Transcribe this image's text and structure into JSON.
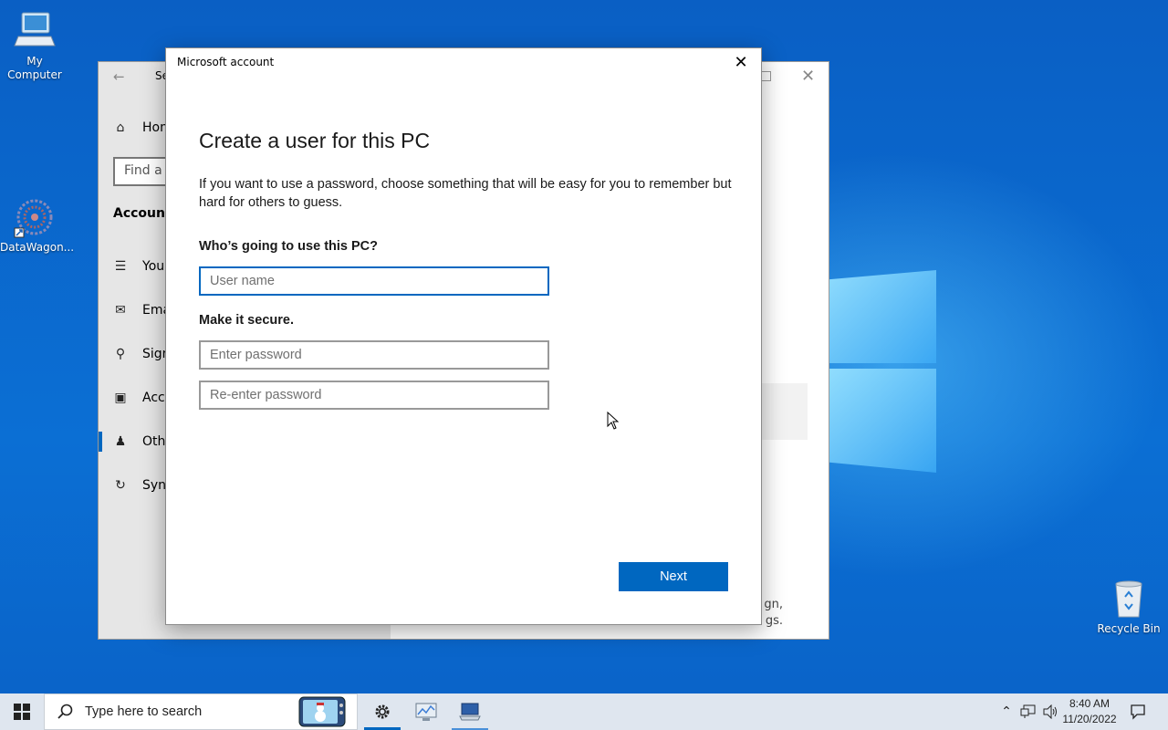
{
  "desktop": {
    "icons": [
      {
        "label": "My Computer"
      },
      {
        "label": "DataWagon..."
      },
      {
        "label": "Recycle Bin"
      }
    ]
  },
  "settings_window": {
    "title": "Se",
    "home": "Hom",
    "search_placeholder": "Find a s",
    "section": "Accounts",
    "nav": [
      {
        "label": "Your",
        "icon": "person-list-icon"
      },
      {
        "label": "Ema",
        "icon": "mail-icon"
      },
      {
        "label": "Sign",
        "icon": "key-icon"
      },
      {
        "label": "Acce",
        "icon": "briefcase-icon"
      },
      {
        "label": "Othe",
        "icon": "person-icon"
      },
      {
        "label": "Sync",
        "icon": "sync-icon"
      }
    ],
    "bottom_text_1": "gn,",
    "bottom_text_2": "gs."
  },
  "dialog": {
    "title": "Microsoft account",
    "heading": "Create a user for this PC",
    "description": "If you want to use a password, choose something that will be easy for you to remember but hard for others to guess.",
    "who_label": "Who’s going to use this PC?",
    "username_placeholder": "User name",
    "secure_label": "Make it secure.",
    "password_placeholder": "Enter password",
    "reenter_placeholder": "Re-enter password",
    "next_label": "Next",
    "accent": "#0067c0"
  },
  "taskbar": {
    "search_placeholder": "Type here to search",
    "time": "8:40 AM",
    "date": "11/20/2022"
  }
}
